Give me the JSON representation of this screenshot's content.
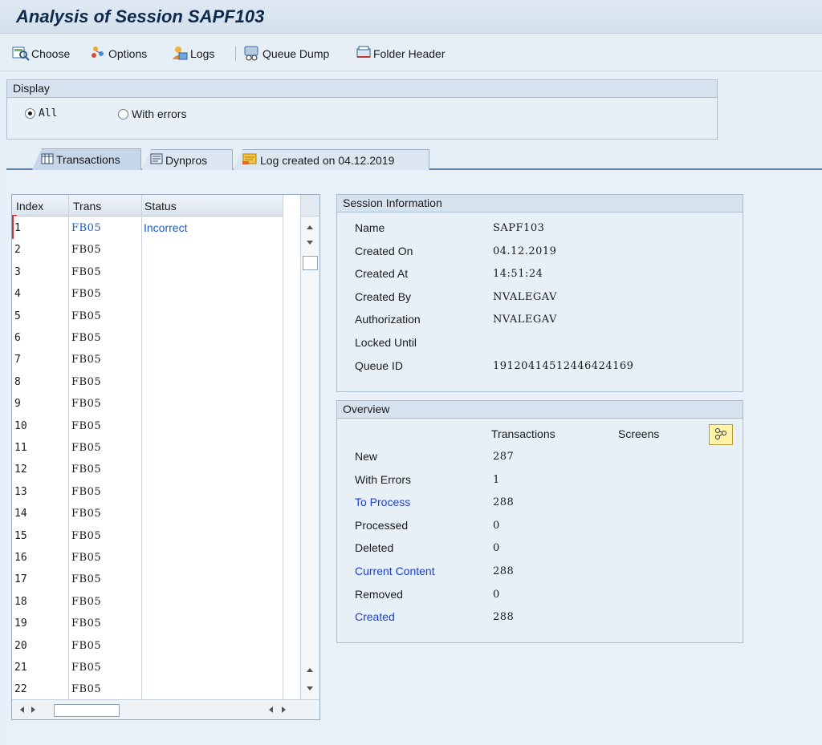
{
  "window": {
    "title": "Analysis of Session SAPF103"
  },
  "toolbar": {
    "buttons": [
      {
        "label": "Choose",
        "icon": "choose-icon"
      },
      {
        "label": "Options",
        "icon": "options-icon"
      },
      {
        "label": "Logs",
        "icon": "logs-icon"
      },
      {
        "label": "Queue Dump",
        "icon": "queue-dump-icon"
      },
      {
        "label": "Folder Header",
        "icon": "folder-header-icon"
      }
    ]
  },
  "display": {
    "heading": "Display",
    "options": [
      {
        "label": "All",
        "selected": true
      },
      {
        "label": "With errors",
        "selected": false
      }
    ]
  },
  "tabs": [
    {
      "label": "Transactions",
      "icon": "table-icon",
      "active": true
    },
    {
      "label": "Dynpros",
      "icon": "dynpros-icon",
      "active": false
    },
    {
      "label": "Log created on 04.12.2019",
      "icon": "log-icon",
      "active": false
    }
  ],
  "table": {
    "columns": [
      "Index",
      "Trans",
      "Status"
    ],
    "rows": [
      {
        "index": "1",
        "trans": "FB05",
        "status": "Incorrect"
      },
      {
        "index": "2",
        "trans": "FB05",
        "status": ""
      },
      {
        "index": "3",
        "trans": "FB05",
        "status": ""
      },
      {
        "index": "4",
        "trans": "FB05",
        "status": ""
      },
      {
        "index": "5",
        "trans": "FB05",
        "status": ""
      },
      {
        "index": "6",
        "trans": "FB05",
        "status": ""
      },
      {
        "index": "7",
        "trans": "FB05",
        "status": ""
      },
      {
        "index": "8",
        "trans": "FB05",
        "status": ""
      },
      {
        "index": "9",
        "trans": "FB05",
        "status": ""
      },
      {
        "index": "10",
        "trans": "FB05",
        "status": ""
      },
      {
        "index": "11",
        "trans": "FB05",
        "status": ""
      },
      {
        "index": "12",
        "trans": "FB05",
        "status": ""
      },
      {
        "index": "13",
        "trans": "FB05",
        "status": ""
      },
      {
        "index": "14",
        "trans": "FB05",
        "status": ""
      },
      {
        "index": "15",
        "trans": "FB05",
        "status": ""
      },
      {
        "index": "16",
        "trans": "FB05",
        "status": ""
      },
      {
        "index": "17",
        "trans": "FB05",
        "status": ""
      },
      {
        "index": "18",
        "trans": "FB05",
        "status": ""
      },
      {
        "index": "19",
        "trans": "FB05",
        "status": ""
      },
      {
        "index": "20",
        "trans": "FB05",
        "status": ""
      },
      {
        "index": "21",
        "trans": "FB05",
        "status": ""
      },
      {
        "index": "22",
        "trans": "FB05",
        "status": ""
      }
    ]
  },
  "session_info": {
    "heading": "Session Information",
    "fields": [
      {
        "label": "Name",
        "value": "SAPF103"
      },
      {
        "label": "Created On",
        "value": "04.12.2019"
      },
      {
        "label": "Created At",
        "value": "14:51:24"
      },
      {
        "label": "Created By",
        "value": "NVALEGAV"
      },
      {
        "label": "Authorization",
        "value": "NVALEGAV"
      },
      {
        "label": "Locked Until",
        "value": ""
      },
      {
        "label": "Queue ID",
        "value": "19120414512446424169"
      }
    ]
  },
  "overview": {
    "heading": "Overview",
    "col_transactions": "Transactions",
    "col_screens": "Screens",
    "rows": [
      {
        "label": "New",
        "value": "287",
        "link": false
      },
      {
        "label": "With Errors",
        "value": "1",
        "link": false
      },
      {
        "label": "To Process",
        "value": "288",
        "link": true
      },
      {
        "label": "Processed",
        "value": "0",
        "link": false
      },
      {
        "label": "Deleted",
        "value": "0",
        "link": false
      },
      {
        "label": "Current Content",
        "value": "288",
        "link": true
      },
      {
        "label": "Removed",
        "value": "0",
        "link": false
      },
      {
        "label": "Created",
        "value": "288",
        "link": true
      }
    ]
  }
}
